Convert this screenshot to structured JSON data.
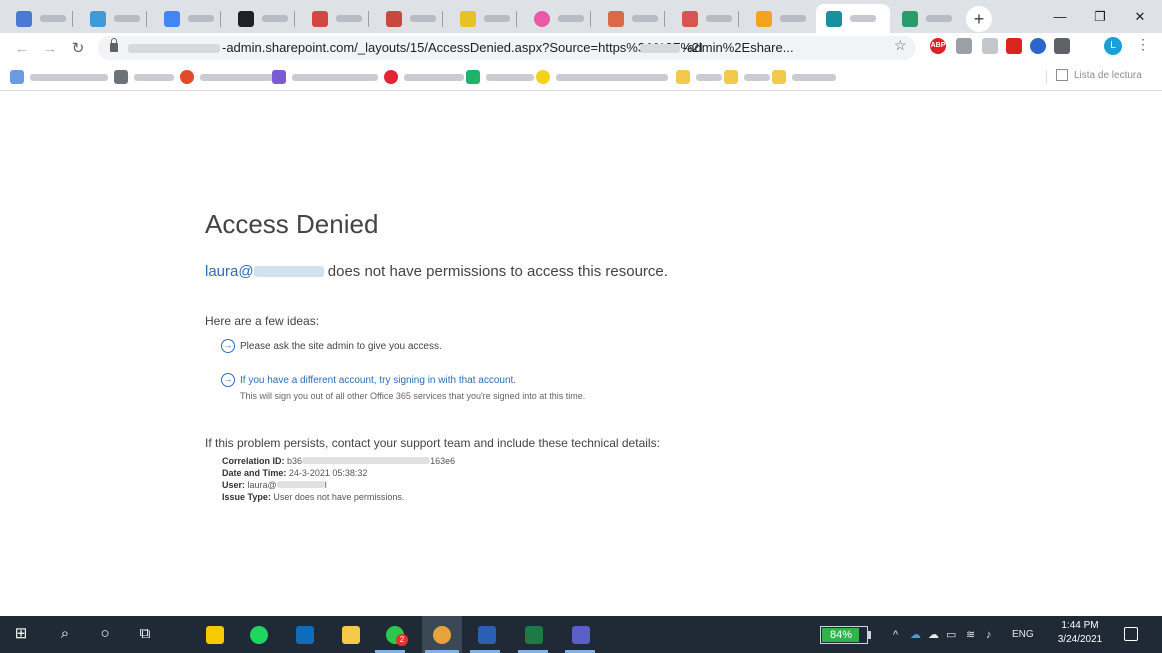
{
  "browser": {
    "url_visible_end": "-admin.sharepoint.com/_layouts/15/AccessDenied.aspx?Source=https%3A%2F%2I",
    "url_visible_tail": "-admin%2Esharе...",
    "reading_list_label": "Lista de lectura",
    "profile_initial": "L",
    "new_tab_label": "+",
    "window_minimize": "—",
    "window_restore": "❐",
    "window_close": "✕",
    "ext_abp_label": "ABP"
  },
  "page": {
    "title": "Access Denied",
    "user_prefix": "laura@",
    "permission_message": "does not have permissions to access this resource.",
    "ideas_heading": "Here are a few ideas:",
    "idea_1": "Please ask the site admin to give you access.",
    "idea_2_link": "If you have a different account, try signing in with that account.",
    "idea_2_sub": "This will sign you out of all other Office 365 services that you're signed into at this time.",
    "persists_message": "If this problem persists, contact your support team and include these technical details:",
    "details": {
      "correlation_label": "Correlation ID:",
      "correlation_start": "b36",
      "correlation_end": "163e6",
      "datetime_label": "Date and Time:",
      "datetime_value": "24-3-2021 05:38:32",
      "user_label": "User:",
      "user_value": "laura@",
      "user_tail": "l",
      "issue_label": "Issue Type:",
      "issue_value": "User does not have permissions."
    }
  },
  "taskbar": {
    "battery_percent_label": "84%",
    "battery_level": 0.84,
    "language": "ENG",
    "time": "1:44 PM",
    "date": "3/24/2021",
    "whatsapp_badge": "2"
  },
  "colors": {
    "link_blue": "#2a6fba",
    "taskbar": "#1f2a36",
    "battery_green": "#2fb34a"
  }
}
